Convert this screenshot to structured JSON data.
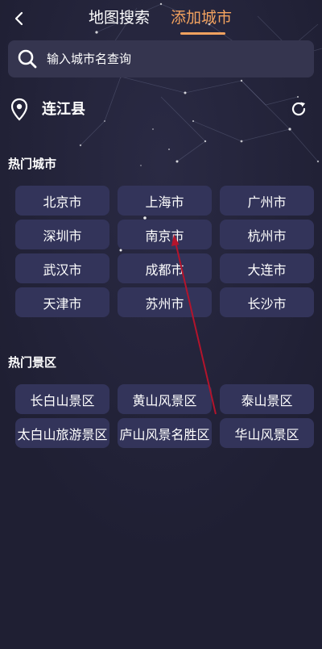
{
  "header": {
    "back_icon": "chevron-left-icon",
    "tabs": [
      {
        "label": "地图搜索",
        "active": false
      },
      {
        "label": "添加城市",
        "active": true
      }
    ]
  },
  "search": {
    "placeholder": "输入城市名查询",
    "icon": "search-icon"
  },
  "location": {
    "icon": "location-pin-icon",
    "city": "连江县",
    "refresh_icon": "refresh-icon"
  },
  "hot_cities": {
    "title": "热门城市",
    "items": [
      "北京市",
      "上海市",
      "广州市",
      "深圳市",
      "南京市",
      "杭州市",
      "武汉市",
      "成都市",
      "大连市",
      "天津市",
      "苏州市",
      "长沙市"
    ]
  },
  "hot_scenic": {
    "title": "热门景区",
    "items": [
      "长白山景区",
      "黄山风景区",
      "泰山景区",
      "太白山旅游景区",
      "庐山风景名胜区",
      "华山风景区"
    ]
  },
  "colors": {
    "background": "#1f1f33",
    "chip": "#33345a",
    "search_bar": "#35354f",
    "accent": "#f2a25f",
    "arrow": "#b3142c"
  }
}
